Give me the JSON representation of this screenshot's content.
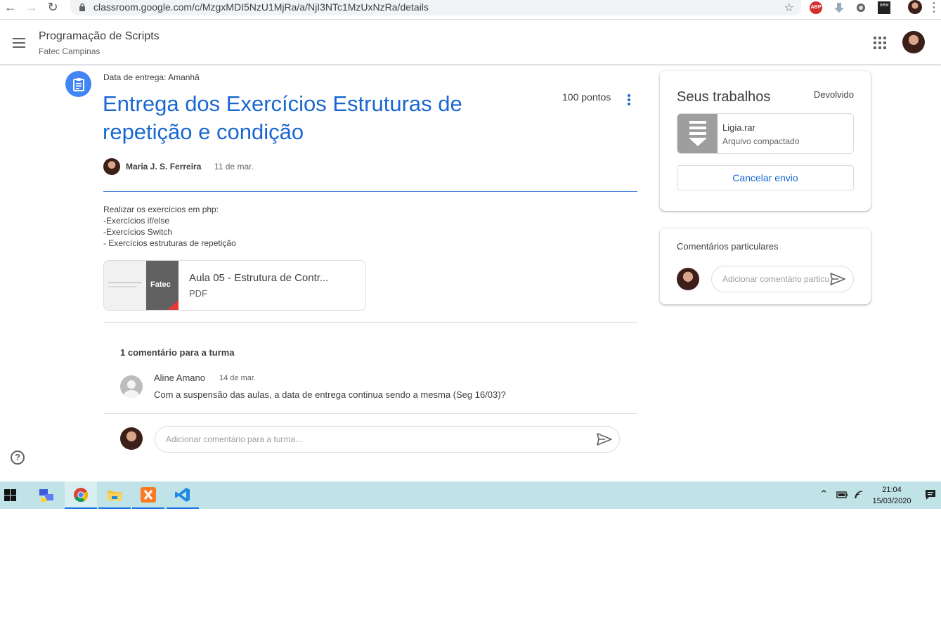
{
  "browser": {
    "url": "classroom.google.com/c/MzgxMDI5NzU1MjRa/a/NjI3NTc1MzUxNzRa/details",
    "ext_abp": "ABP",
    "ext_new": "new"
  },
  "header": {
    "class_name": "Programação de Scripts",
    "class_section": "Fatec Campinas"
  },
  "assignment": {
    "due": "Data de entrega: Amanhã",
    "title": "Entrega dos Exercícios Estruturas de repetição e condição",
    "points": "100 pontos",
    "author": "Maria J. S. Ferreira",
    "date": "11 de mar.",
    "description": [
      "Realizar os exercícios em php:",
      "-Exercícios if/else",
      "-Exercícios Switch",
      "- Exercícios estruturas de repetição"
    ],
    "attachment": {
      "name": "Aula 05 - Estrutura de Contr...",
      "type": "PDF",
      "thumb_label": "Fatec"
    }
  },
  "class_comments": {
    "count_label": "1 comentário para a turma",
    "items": [
      {
        "author": "Aline Amano",
        "date": "14 de mar.",
        "text": "Com a suspensão das aulas, a data de entrega continua sendo a mesma (Seg 16/03)?"
      }
    ],
    "input_placeholder": "Adicionar comentário para a turma..."
  },
  "your_work": {
    "title": "Seus trabalhos",
    "status": "Devolvido",
    "file": {
      "name": "Ligia.rar",
      "type": "Arquivo compactado"
    },
    "cancel_label": "Cancelar envio"
  },
  "private_comments": {
    "title": "Comentários particulares",
    "input_placeholder": "Adicionar comentário particular..."
  },
  "help_label": "?",
  "taskbar": {
    "time": "21:04",
    "date": "15/03/2020"
  },
  "colors": {
    "accent": "#1967d2",
    "assignment_icon": "#4285f4",
    "taskbar": "#bfe3e6"
  },
  "icons": [
    "back-icon",
    "forward-icon",
    "reload-icon",
    "lock-icon",
    "star-icon",
    "menu-icon",
    "apps-icon",
    "assignment-icon",
    "more-vert-icon",
    "send-icon",
    "help-icon",
    "windows-start-icon",
    "chrome-icon",
    "file-explorer-icon",
    "xampp-icon",
    "vscode-icon",
    "notifications-icon"
  ]
}
